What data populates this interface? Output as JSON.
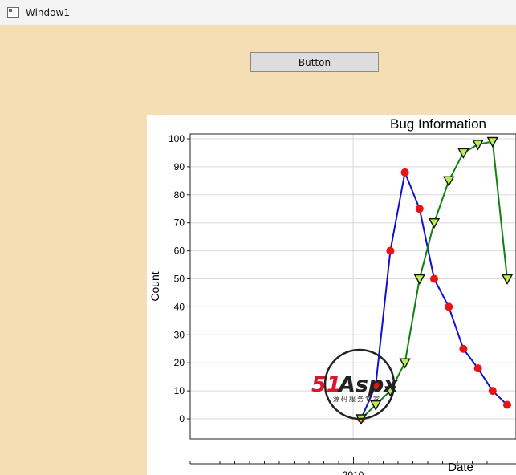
{
  "window": {
    "title": "Window1",
    "icon": "window-app-icon"
  },
  "button": {
    "label": "Button"
  },
  "colors": {
    "client_background": "#f5deb3",
    "series_blue": "#1010d0",
    "series_green": "#108010",
    "marker_red": "#ee1111",
    "marker_yellow": "#b8f050"
  },
  "watermark": {
    "logo_text": "51Aspx",
    "tagline": "源码服务专家"
  },
  "chart_data": {
    "type": "line",
    "title": "Bug Information",
    "xlabel": "Date",
    "ylabel": "Count",
    "ylim": [
      0,
      100
    ],
    "y_ticks": [
      "0",
      "10",
      "20",
      "30",
      "40",
      "50",
      "60",
      "70",
      "80",
      "90",
      "100"
    ],
    "x_tick_labels": [
      "2010"
    ],
    "grid": true,
    "series": [
      {
        "values": [
          0,
          12,
          60,
          88,
          75,
          50,
          40,
          25,
          18,
          10,
          5
        ],
        "marker": "circle"
      },
      {
        "values": [
          0,
          5,
          10,
          20,
          50,
          70,
          85,
          95,
          98,
          99,
          50
        ],
        "marker": "triangle-down"
      }
    ]
  }
}
